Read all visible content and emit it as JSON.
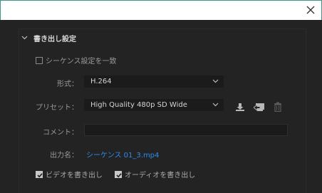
{
  "window": {
    "close_icon": "close-icon"
  },
  "section": {
    "title": "書き出し設定",
    "chevron_icon": "chevron-down-icon"
  },
  "match_sequence": {
    "label": "シーケンス設定を一致",
    "checked": false
  },
  "format": {
    "label": "形式：",
    "value": "H.264"
  },
  "preset": {
    "label": "プリセット：",
    "value": "High Quality 480p SD Wide",
    "icons": [
      "save-preset-icon",
      "import-preset-icon",
      "delete-preset-icon"
    ]
  },
  "comment": {
    "label": "コメント：",
    "value": ""
  },
  "output_name": {
    "label": "出力名：",
    "value": "シーケンス 01_3.mp4"
  },
  "export_video": {
    "label": "ビデオを書き出し",
    "checked": true
  },
  "export_audio": {
    "label": "オーディオを書き出し",
    "checked": true
  },
  "colors": {
    "background": "#232323",
    "field_background": "#1b1b1b",
    "link": "#2d8ceb",
    "titlebar_border": "#3a9a8a"
  }
}
